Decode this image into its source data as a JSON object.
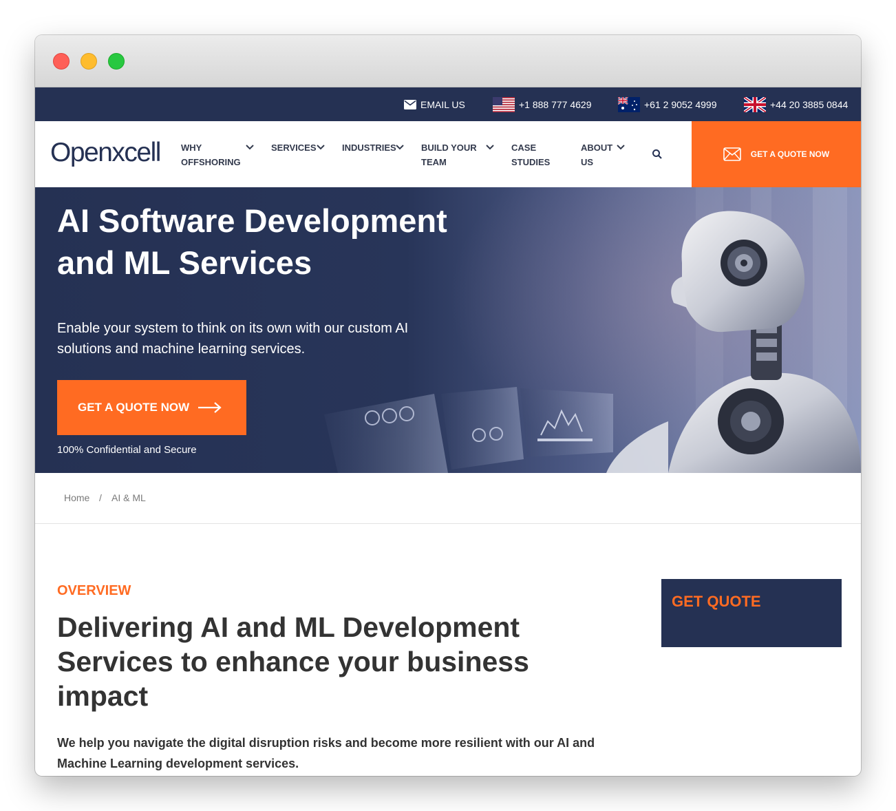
{
  "topbar": {
    "email_label": "EMAIL US",
    "phones": [
      {
        "number": "+1 888 777 4629",
        "flag": "us-flag-icon"
      },
      {
        "number": "+61 2 9052 4999",
        "flag": "au-flag-icon"
      },
      {
        "number": "+44 20 3885 0844",
        "flag": "uk-flag-icon"
      }
    ]
  },
  "nav": {
    "logo": "Openxcell",
    "items": [
      {
        "line1": "WHY",
        "line2": "OFFSHORING"
      },
      {
        "line1": "SERVICES",
        "line2": ""
      },
      {
        "line1": "INDUSTRIES",
        "line2": ""
      },
      {
        "line1": "BUILD YOUR",
        "line2": "TEAM"
      },
      {
        "line1": "CASE",
        "line2": "STUDIES"
      },
      {
        "line1": "ABOUT",
        "line2": "US"
      }
    ],
    "cta": "GET A QUOTE NOW"
  },
  "hero": {
    "title_line1": "AI Software Development",
    "title_line2": "and ML Services",
    "subtitle": "Enable your system to think on its own with our custom AI solutions and machine learning services.",
    "button": "GET A QUOTE NOW",
    "note": "100% Confidential and Secure"
  },
  "breadcrumb": {
    "home": "Home",
    "separator": "/",
    "current": "AI & ML"
  },
  "overview": {
    "eyebrow": "OVERVIEW",
    "heading": "Delivering AI and ML Development Services to enhance your business impact",
    "paragraph": "We help you navigate the digital disruption risks and become more resilient with our AI and Machine Learning development services."
  },
  "sidebar": {
    "quote_title": "GET QUOTE"
  },
  "colors": {
    "navy": "#253153",
    "orange": "#ff6b22"
  }
}
